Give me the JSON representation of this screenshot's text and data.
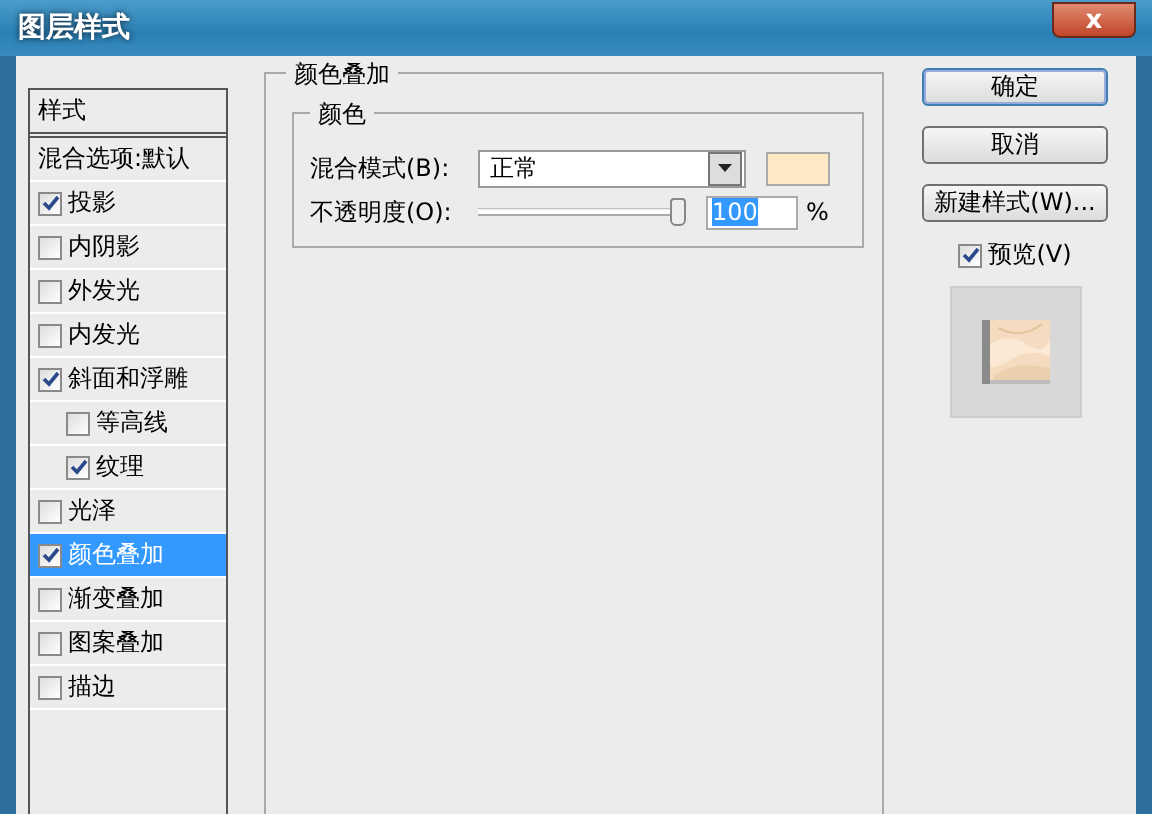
{
  "window": {
    "title": "图层样式",
    "close": "x"
  },
  "sidebar": {
    "header": "样式",
    "blend_options": "混合选项:默认",
    "items": [
      {
        "label": "投影",
        "checked": true,
        "selected": false
      },
      {
        "label": "内阴影",
        "checked": false,
        "selected": false
      },
      {
        "label": "外发光",
        "checked": false,
        "selected": false
      },
      {
        "label": "内发光",
        "checked": false,
        "selected": false
      },
      {
        "label": "斜面和浮雕",
        "checked": true,
        "selected": false,
        "children": [
          {
            "label": "等高线",
            "checked": false,
            "selected": false
          },
          {
            "label": "纹理",
            "checked": true,
            "selected": false
          }
        ]
      },
      {
        "label": "光泽",
        "checked": false,
        "selected": false
      },
      {
        "label": "颜色叠加",
        "checked": true,
        "selected": true
      },
      {
        "label": "渐变叠加",
        "checked": false,
        "selected": false
      },
      {
        "label": "图案叠加",
        "checked": false,
        "selected": false
      },
      {
        "label": "描边",
        "checked": false,
        "selected": false
      }
    ]
  },
  "panel": {
    "title": "颜色叠加",
    "group": {
      "title": "颜色",
      "blend_mode": {
        "label": "混合模式(B):",
        "value": "正常",
        "color": "#ffe9c4"
      },
      "opacity": {
        "label": "不透明度(O):",
        "level": 1,
        "value": "100",
        "unit": "%"
      }
    }
  },
  "buttons": [
    "确定",
    "取消",
    "新建样式(W)..."
  ],
  "preview": {
    "label": "预览(V)",
    "checked": true
  }
}
